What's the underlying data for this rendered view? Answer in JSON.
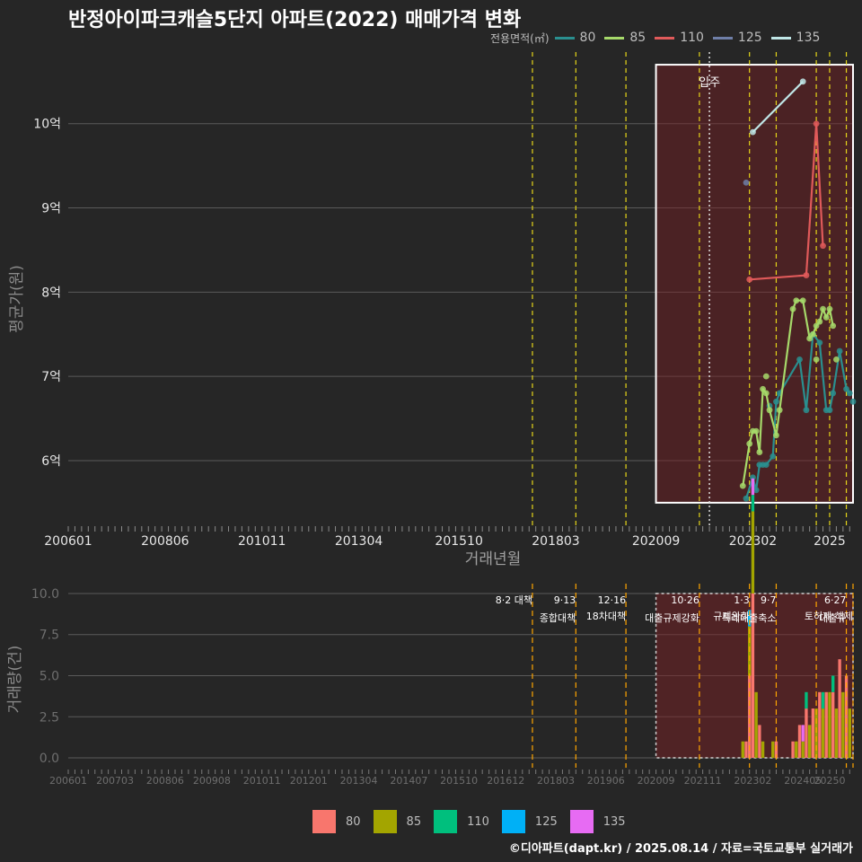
{
  "title": "반정아이파크캐슬5단지 아파트(2022) 매매가격 변화",
  "legend": {
    "title": "전용면적(㎡)",
    "items": [
      {
        "label": "80",
        "line_color": "#2a8f8f",
        "bar_color": "#f8766d"
      },
      {
        "label": "85",
        "line_color": "#a6d96a",
        "bar_color": "#a3a500"
      },
      {
        "label": "110",
        "line_color": "#e05a5a",
        "bar_color": "#00bf7d"
      },
      {
        "label": "125",
        "line_color": "#6f7fa8",
        "bar_color": "#00b0f6"
      },
      {
        "label": "135",
        "line_color": "#bfe6e6",
        "bar_color": "#e76bf3"
      }
    ]
  },
  "footer": "©디아파트(dapt.kr) / 2025.08.14 / 자료=국토교통부 실거래가",
  "chart_data": [
    {
      "type": "line",
      "xlabel": "거래년월",
      "ylabel": "평균가(원)",
      "x_ticks": [
        "200601",
        "200806",
        "201011",
        "201304",
        "201510",
        "201803",
        "202009",
        "202302",
        "2025"
      ],
      "y_ticks": [
        {
          "v": 6,
          "label": "6억"
        },
        {
          "v": 7,
          "label": "7억"
        },
        {
          "v": 8,
          "label": "8억"
        },
        {
          "v": 9,
          "label": "9억"
        },
        {
          "v": 10,
          "label": "10억"
        }
      ],
      "xlim": [
        "2006-01",
        "2025-08"
      ],
      "ylim": [
        5.2,
        10.85
      ],
      "highlight": {
        "from": "2020-09",
        "to": "2025-08",
        "ymin": 5.5,
        "ymax": 10.7
      },
      "annotation": {
        "text": "입주",
        "x": "2022-01",
        "y": 10.5
      },
      "policy_lines": [
        "2017-08",
        "2018-09",
        "2019-12",
        "2021-10",
        "2022-01",
        "2023-01",
        "2023-09",
        "2024-09",
        "2025-01",
        "2025-06"
      ],
      "series": [
        {
          "name": "80",
          "points": [
            [
              "2022-12",
              5.55
            ],
            [
              "2023-02",
              5.8
            ],
            [
              "2023-03",
              5.65
            ],
            [
              "2023-04",
              5.95
            ],
            [
              "2023-05",
              5.95
            ],
            [
              "2023-06",
              5.95
            ],
            [
              "2023-08",
              6.05
            ],
            [
              "2023-09",
              6.7
            ],
            [
              "2023-10",
              6.8
            ],
            [
              "2024-04",
              7.2
            ],
            [
              "2024-06",
              6.6
            ],
            [
              "2024-08",
              7.5
            ],
            [
              "2024-10",
              7.4
            ],
            [
              "2024-12",
              6.6
            ],
            [
              "2025-01",
              6.6
            ],
            [
              "2025-02",
              6.8
            ],
            [
              "2025-04",
              7.3
            ],
            [
              "2025-06",
              6.85
            ],
            [
              "2025-07",
              6.8
            ]
          ],
          "extra_points": [
            [
              "2023-07",
              6.65
            ],
            [
              "2025-08",
              6.7
            ]
          ]
        },
        {
          "name": "85",
          "points": [
            [
              "2022-11",
              5.7
            ],
            [
              "2023-01",
              6.2
            ],
            [
              "2023-02",
              6.35
            ],
            [
              "2023-03",
              6.35
            ],
            [
              "2023-04",
              6.1
            ],
            [
              "2023-05",
              6.85
            ],
            [
              "2023-06",
              6.8
            ],
            [
              "2023-07",
              6.6
            ],
            [
              "2023-09",
              6.3
            ],
            [
              "2024-02",
              7.8
            ],
            [
              "2024-03",
              7.9
            ],
            [
              "2024-05",
              7.9
            ],
            [
              "2024-07",
              7.45
            ],
            [
              "2024-08",
              7.5
            ],
            [
              "2024-09",
              7.6
            ],
            [
              "2024-10",
              7.65
            ],
            [
              "2024-11",
              7.8
            ],
            [
              "2024-12",
              7.7
            ],
            [
              "2025-01",
              7.8
            ],
            [
              "2025-02",
              7.6
            ]
          ],
          "extra_points": [
            [
              "2023-06",
              7.0
            ],
            [
              "2023-10",
              6.6
            ],
            [
              "2024-09",
              7.2
            ],
            [
              "2025-03",
              7.2
            ]
          ]
        },
        {
          "name": "110",
          "points": [
            [
              "2023-01",
              8.15
            ],
            [
              "2024-06",
              8.2
            ],
            [
              "2024-09",
              10.0
            ],
            [
              "2024-11",
              8.55
            ]
          ],
          "extra_points": []
        },
        {
          "name": "125",
          "points": [],
          "extra_points": [
            [
              "2022-12",
              9.3
            ]
          ]
        },
        {
          "name": "135",
          "points": [
            [
              "2023-02",
              9.9
            ],
            [
              "2024-05",
              10.5
            ]
          ],
          "extra_points": []
        }
      ]
    },
    {
      "type": "bar",
      "xlabel": "",
      "ylabel": "거래량(건)",
      "x_ticks": [
        "200601",
        "200703",
        "200806",
        "200908",
        "201011",
        "201201",
        "201304",
        "201407",
        "201510",
        "201612",
        "201803",
        "201906",
        "202009",
        "202111",
        "202302",
        "202405",
        "20250"
      ],
      "y_ticks": [
        {
          "v": 0,
          "label": "0.0"
        },
        {
          "v": 2.5,
          "label": "2.5"
        },
        {
          "v": 5,
          "label": "5.0"
        },
        {
          "v": 7.5,
          "label": "7.5"
        },
        {
          "v": 10,
          "label": "10.0"
        }
      ],
      "xlim": [
        "2006-01",
        "2025-08"
      ],
      "ylim": [
        -0.6,
        10.6
      ],
      "highlight": {
        "from": "2020-09",
        "to": "2025-08",
        "ymin": 0,
        "ymax": 10
      },
      "policy_events": [
        {
          "x": "2017-08",
          "label": "8·2 대책",
          "sublabel": ""
        },
        {
          "x": "2018-09",
          "label": "9·13",
          "sublabel": "종합대책"
        },
        {
          "x": "2019-12",
          "label": "12·16",
          "sublabel": "18차대책"
        },
        {
          "x": "2021-10",
          "label": "10·26",
          "sublabel": "대출규제강화"
        },
        {
          "x": "2023-01",
          "label": "1·3",
          "sublabel": "규제완화"
        },
        {
          "x": "2023-09",
          "label": "9·7",
          "sublabel": "특례대출축소"
        },
        {
          "x": "2024-09",
          "label": "",
          "sublabel": ""
        },
        {
          "x": "2025-06",
          "label": "6·27",
          "sublabel": "대출규"
        },
        {
          "x": "2025-08",
          "label": "",
          "sublabel": "토허제 해제"
        }
      ],
      "series": [
        {
          "name": "80",
          "values": [
            [
              "2022-12",
              1
            ],
            [
              "2023-01",
              5
            ],
            [
              "2023-02",
              10
            ],
            [
              "2023-04",
              2
            ],
            [
              "2023-09",
              1
            ],
            [
              "2024-02",
              1
            ],
            [
              "2024-04",
              2
            ],
            [
              "2024-06",
              3
            ],
            [
              "2024-08",
              3
            ],
            [
              "2024-10",
              4
            ],
            [
              "2024-12",
              4
            ],
            [
              "2025-02",
              4
            ],
            [
              "2025-04",
              6
            ],
            [
              "2025-06",
              5
            ]
          ]
        },
        {
          "name": "85",
          "values": [
            [
              "2022-11",
              1
            ],
            [
              "2023-01",
              3
            ],
            [
              "2023-02",
              5
            ],
            [
              "2023-03",
              4
            ],
            [
              "2023-05",
              1
            ],
            [
              "2023-08",
              1
            ],
            [
              "2024-03",
              1
            ],
            [
              "2024-05",
              1
            ],
            [
              "2024-07",
              2
            ],
            [
              "2024-09",
              3
            ],
            [
              "2024-11",
              3
            ],
            [
              "2025-01",
              4
            ],
            [
              "2025-03",
              3
            ],
            [
              "2025-05",
              4
            ],
            [
              "2025-07",
              3
            ]
          ]
        },
        {
          "name": "110",
          "values": [
            [
              "2023-02",
              1
            ],
            [
              "2024-06",
              1
            ],
            [
              "2024-11",
              1
            ],
            [
              "2025-02",
              1
            ]
          ]
        },
        {
          "name": "125",
          "values": [
            [
              "2023-01",
              1
            ]
          ]
        },
        {
          "name": "135",
          "values": [
            [
              "2023-02",
              1
            ],
            [
              "2024-05",
              1
            ]
          ]
        }
      ]
    }
  ]
}
